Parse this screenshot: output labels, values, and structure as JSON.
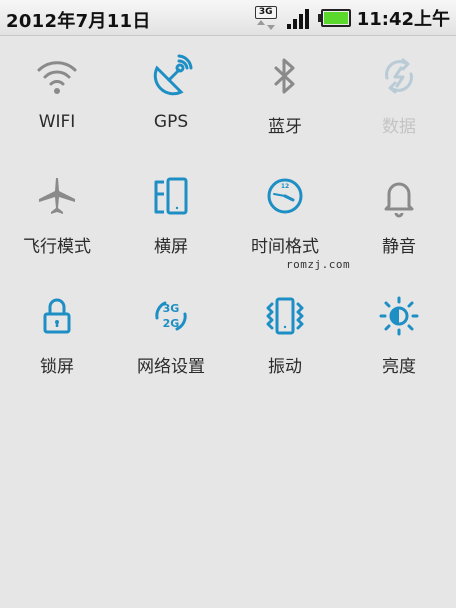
{
  "status_bar": {
    "date": "2012年7月11日",
    "network": "3G",
    "signal_bars": 4,
    "battery_level": 1.0,
    "battery_color": "#5ad82b",
    "time": "11:42上午"
  },
  "toggles": [
    {
      "label": "WIFI",
      "icon": "wifi-icon",
      "enabled": true
    },
    {
      "label": "GPS",
      "icon": "gps-icon",
      "enabled": true
    },
    {
      "label": "蓝牙",
      "icon": "bluetooth-icon",
      "enabled": true
    },
    {
      "label": "数据",
      "icon": "data-sync-icon",
      "enabled": false
    },
    {
      "label": "飞行模式",
      "icon": "airplane-icon",
      "enabled": true
    },
    {
      "label": "横屏",
      "icon": "rotate-screen-icon",
      "enabled": true
    },
    {
      "label": "时间格式",
      "icon": "clock-icon",
      "enabled": true
    },
    {
      "label": "静音",
      "icon": "bell-icon",
      "enabled": true
    },
    {
      "label": "锁屏",
      "icon": "lock-icon",
      "enabled": true
    },
    {
      "label": "网络设置",
      "icon": "network-3g-2g-icon",
      "enabled": true
    },
    {
      "label": "振动",
      "icon": "vibrate-icon",
      "enabled": true
    },
    {
      "label": "亮度",
      "icon": "brightness-icon",
      "enabled": true
    }
  ],
  "watermark": "romzj.com",
  "colors": {
    "accent": "#1e8fc4",
    "icon_gray": "#8a8a8a",
    "background": "#e6e6e6"
  }
}
